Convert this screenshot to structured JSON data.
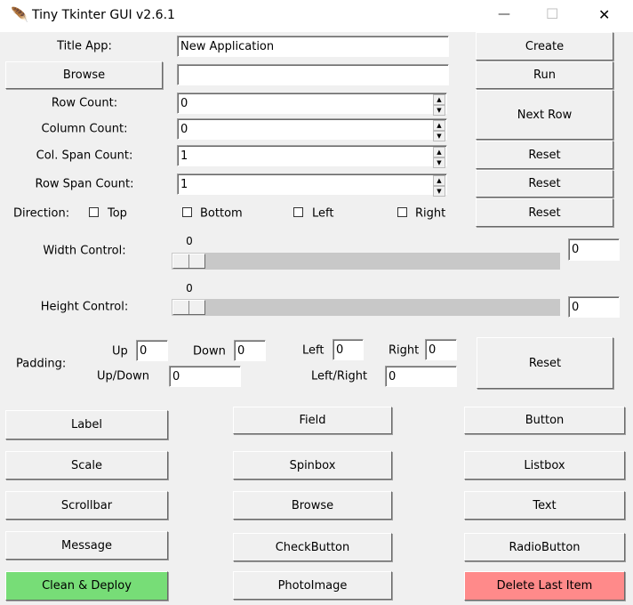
{
  "window": {
    "title": "Tiny Tkinter GUI v2.6.1",
    "minimize": "—",
    "maximize": "☐",
    "close": "✕"
  },
  "form": {
    "title_label": "Title App:",
    "title_value": "New Application",
    "browse_label": "Browse",
    "browse_value": "",
    "row_count_label": "Row Count:",
    "row_count": "0",
    "column_count_label": "Column Count:",
    "column_count": "0",
    "col_span_label": "Col. Span Count:",
    "col_span": "1",
    "row_span_label": "Row Span Count:",
    "row_span": "1",
    "direction_label": "Direction:",
    "directions": [
      "Top",
      "Bottom",
      "Left",
      "Right"
    ]
  },
  "side_buttons": {
    "create": "Create",
    "run": "Run",
    "next_row": "Next Row",
    "reset1": "Reset",
    "reset2": "Reset",
    "reset3": "Reset"
  },
  "width": {
    "label": "Width Control:",
    "value_label": "0",
    "entry": "0"
  },
  "height": {
    "label": "Height Control:",
    "value_label": "0",
    "entry": "0"
  },
  "padding": {
    "label": "Padding:",
    "up": "Up",
    "up_value": "0",
    "down": "Down",
    "down_value": "0",
    "left": "Left",
    "left_value": "0",
    "right": "Right",
    "right_value": "0",
    "updown": "Up/Down",
    "updown_value": "0",
    "leftright": "Left/Right",
    "leftright_value": "0",
    "reset": "Reset"
  },
  "widgets": {
    "label": "Label",
    "field": "Field",
    "button": "Button",
    "scale": "Scale",
    "spinbox": "Spinbox",
    "listbox": "Listbox",
    "scrollbar": "Scrollbar",
    "browse": "Browse",
    "text": "Text",
    "message": "Message",
    "checkbutton": "CheckButton",
    "radiobutton": "RadioButton",
    "clean": "Clean & Deploy",
    "photoimage": "PhotoImage",
    "delete": "Delete Last Item"
  },
  "colors": {
    "clean": "#77dd77",
    "delete": "#ff8a8a"
  }
}
